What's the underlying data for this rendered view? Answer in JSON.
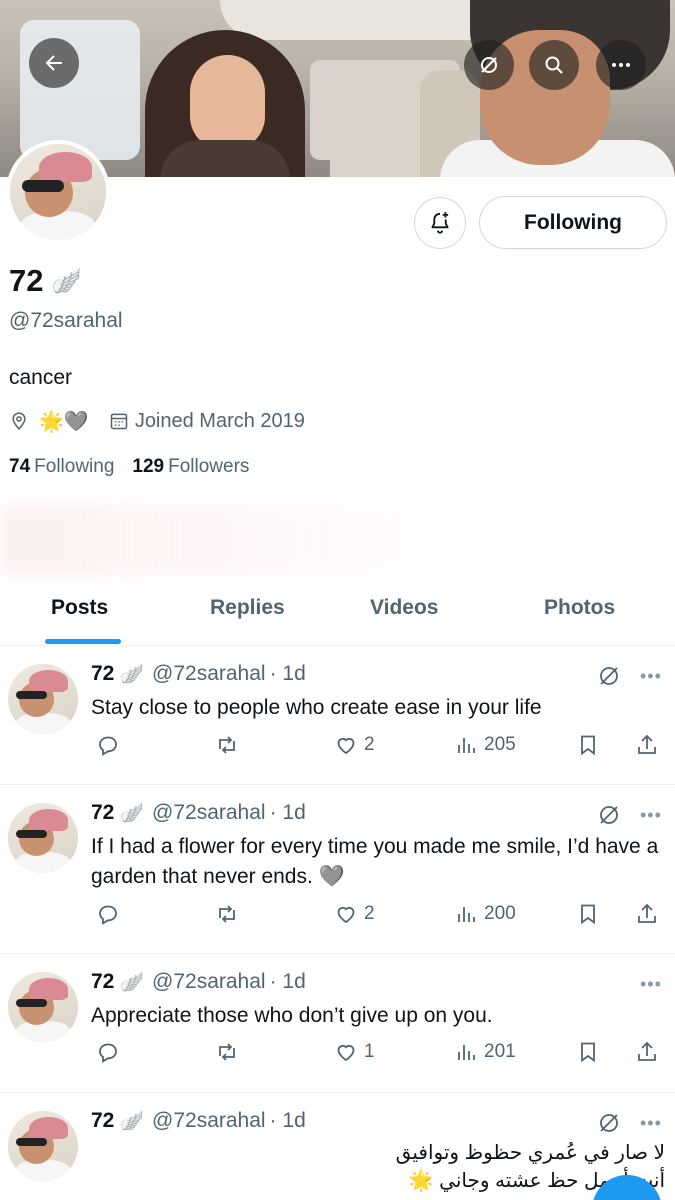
{
  "profile": {
    "display_name": "72",
    "name_emoji": "🪽",
    "handle": "@72sarahal",
    "bio": "cancer",
    "location_emojis": "🌟🩶",
    "joined": "Joined March 2019",
    "following_count": "74",
    "following_label": "Following",
    "followers_count": "129",
    "followers_label": "Followers",
    "follow_button_label": "Following"
  },
  "tabs": [
    {
      "label": "Posts",
      "active": true
    },
    {
      "label": "Replies",
      "active": false
    },
    {
      "label": "Videos",
      "active": false
    },
    {
      "label": "Photos",
      "active": false
    }
  ],
  "posts": [
    {
      "name": "72",
      "emoji": "🪽",
      "handle": "@72sarahal",
      "time": "· 1d",
      "text": "Stay close to people who create ease in your life",
      "likes": "2",
      "views": "205"
    },
    {
      "name": "72",
      "emoji": "🪽",
      "handle": "@72sarahal",
      "time": "· 1d",
      "text": "If I had a flower for every time you made me smile, I’d have a garden that never ends. 🩶",
      "likes": "2",
      "views": "200"
    },
    {
      "name": "72",
      "emoji": "🪽",
      "handle": "@72sarahal",
      "time": "· 1d",
      "text": "Appreciate those who don’t give up on you.",
      "likes": "1",
      "views": "201"
    },
    {
      "name": "72",
      "emoji": "🪽",
      "handle": "@72sarahal",
      "time": "· 1d",
      "text": "لا صار في عُمري حظوظ وتوافيق أنت أجمل حظ عشته وجاني 🌟"
    }
  ],
  "colors": {
    "accent": "#1d9bf0",
    "text_primary": "#0f1419",
    "text_secondary": "#536471",
    "divider": "#eff3f4"
  },
  "icons": {
    "back": "arrow-left-icon",
    "grok": "grok-icon",
    "search": "search-icon",
    "more": "more-icon",
    "notifications": "bell-plus-icon",
    "location": "location-pin-icon",
    "calendar": "calendar-icon",
    "reply": "reply-icon",
    "repost": "repost-icon",
    "like": "heart-icon",
    "views": "views-icon",
    "bookmark": "bookmark-icon",
    "share": "share-icon"
  }
}
